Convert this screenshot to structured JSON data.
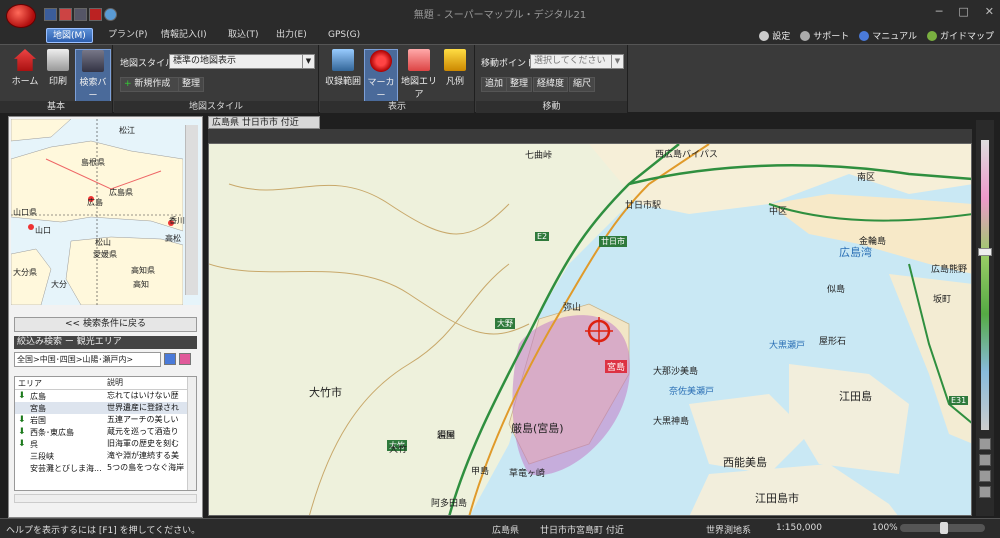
{
  "window": {
    "title": "無題 - スーパーマップル・デジタル21"
  },
  "menu": {
    "tabs": [
      "地図(M)",
      "プラン(P)",
      "情報記入(I)",
      "取込(T)",
      "出力(E)",
      "GPS(G)"
    ],
    "right_links": [
      "設定",
      "サポート",
      "マニュアル",
      "ガイドマップ"
    ]
  },
  "ribbon": {
    "basic": {
      "label": "基本",
      "buttons": [
        "ホーム",
        "印刷",
        "検索バー"
      ]
    },
    "map_style": {
      "label": "地図スタイル",
      "field_label": "地図スタイル",
      "select_value": "標準の地図表示",
      "new_button": "新規作成",
      "organize_button": "整理"
    },
    "display": {
      "label": "表示",
      "buttons": [
        "収録範囲",
        "マーカー",
        "地図エリア",
        "凡例"
      ]
    },
    "move": {
      "label": "移動",
      "field_label": "移動ポイント",
      "select_placeholder": "選択してください",
      "buttons": [
        "追加",
        "整理",
        "経緯度",
        "縮尺"
      ]
    }
  },
  "sidebar": {
    "minimap_labels": [
      "松江",
      "島根県",
      "広島県",
      "広島",
      "山口県",
      "山口",
      "香川",
      "高松",
      "松山",
      "愛媛県",
      "高知県",
      "高知",
      "大分県",
      "大分"
    ],
    "back_button": "<< 検索条件に戻る",
    "filter_header": "絞込み検索 ー 観光エリア",
    "breadcrumb": "全国>中国･四国>山陽･瀬戸内>",
    "columns": [
      "エリア",
      "説明"
    ],
    "rows": [
      {
        "area": "広島",
        "desc": "忘れてはいけない歴",
        "arrow": true
      },
      {
        "area": "宮島",
        "desc": "世界遺産に登録され",
        "arrow": false
      },
      {
        "area": "岩国",
        "desc": "五連アーチの美しい",
        "arrow": true
      },
      {
        "area": "西条･東広島",
        "desc": "蔵元を巡って酒造り",
        "arrow": true
      },
      {
        "area": "呉",
        "desc": "旧海軍の歴史を刻む",
        "arrow": true
      },
      {
        "area": "三段峡",
        "desc": "滝や淵が連続する美",
        "arrow": false
      },
      {
        "area": "安芸灘とびしま海...",
        "desc": "5つの島をつなぐ海岸",
        "arrow": false
      }
    ]
  },
  "map": {
    "tab": "広島県 廿日市市 付近",
    "labels": [
      "七曲峠",
      "西広島バイパス",
      "廿日市駅",
      "中区",
      "南区",
      "広島湾",
      "廿日市",
      "大竹市",
      "厳島(宮島)",
      "江田島",
      "西能美島",
      "江田島市",
      "弥山",
      "宮島",
      "大野",
      "大竹",
      "須屋",
      "甲島",
      "阿多田島",
      "大那沙美島",
      "大黒神島",
      "似島",
      "金輪島",
      "屋形石",
      "坂町",
      "広島熊野",
      "奈佐美瀬戸",
      "大黒瀬戸",
      "岩国",
      "大竹",
      "草竜ヶ崎",
      "E2",
      "E31"
    ]
  },
  "status": {
    "help": "ヘルプを表示するには [F1] を押してください。",
    "pref": "広島県",
    "place": "廿日市市宮島町 付近",
    "datum": "世界測地系",
    "scale": "1:150,000",
    "zoom": "100%"
  }
}
